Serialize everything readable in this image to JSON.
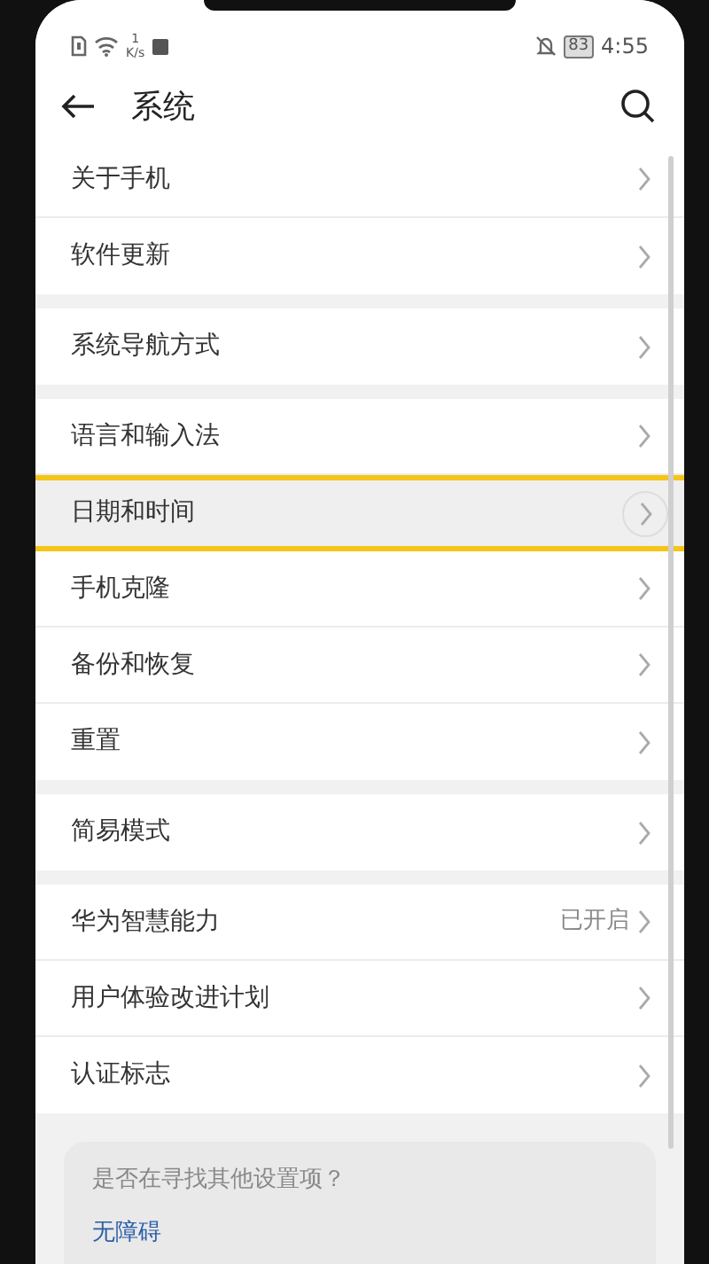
{
  "status_bar": {
    "network_speed": "1",
    "speed_unit": "K/s",
    "battery": "83",
    "time": "4:55"
  },
  "header": {
    "title": "系统"
  },
  "groups": [
    {
      "items": [
        {
          "label": "关于手机",
          "highlighted": false
        },
        {
          "label": "软件更新",
          "highlighted": false
        }
      ]
    },
    {
      "items": [
        {
          "label": "系统导航方式",
          "highlighted": false
        }
      ]
    },
    {
      "items": [
        {
          "label": "语言和输入法",
          "highlighted": false
        },
        {
          "label": "日期和时间",
          "highlighted": true
        },
        {
          "label": "手机克隆",
          "highlighted": false
        },
        {
          "label": "备份和恢复",
          "highlighted": false
        },
        {
          "label": "重置",
          "highlighted": false
        }
      ]
    },
    {
      "items": [
        {
          "label": "简易模式",
          "highlighted": false
        }
      ]
    },
    {
      "items": [
        {
          "label": "华为智慧能力",
          "value": "已开启",
          "highlighted": false
        },
        {
          "label": "用户体验改进计划",
          "highlighted": false
        },
        {
          "label": "认证标志",
          "highlighted": false
        }
      ]
    }
  ],
  "suggestion": {
    "title": "是否在寻找其他设置项？",
    "link": "无障碍"
  }
}
